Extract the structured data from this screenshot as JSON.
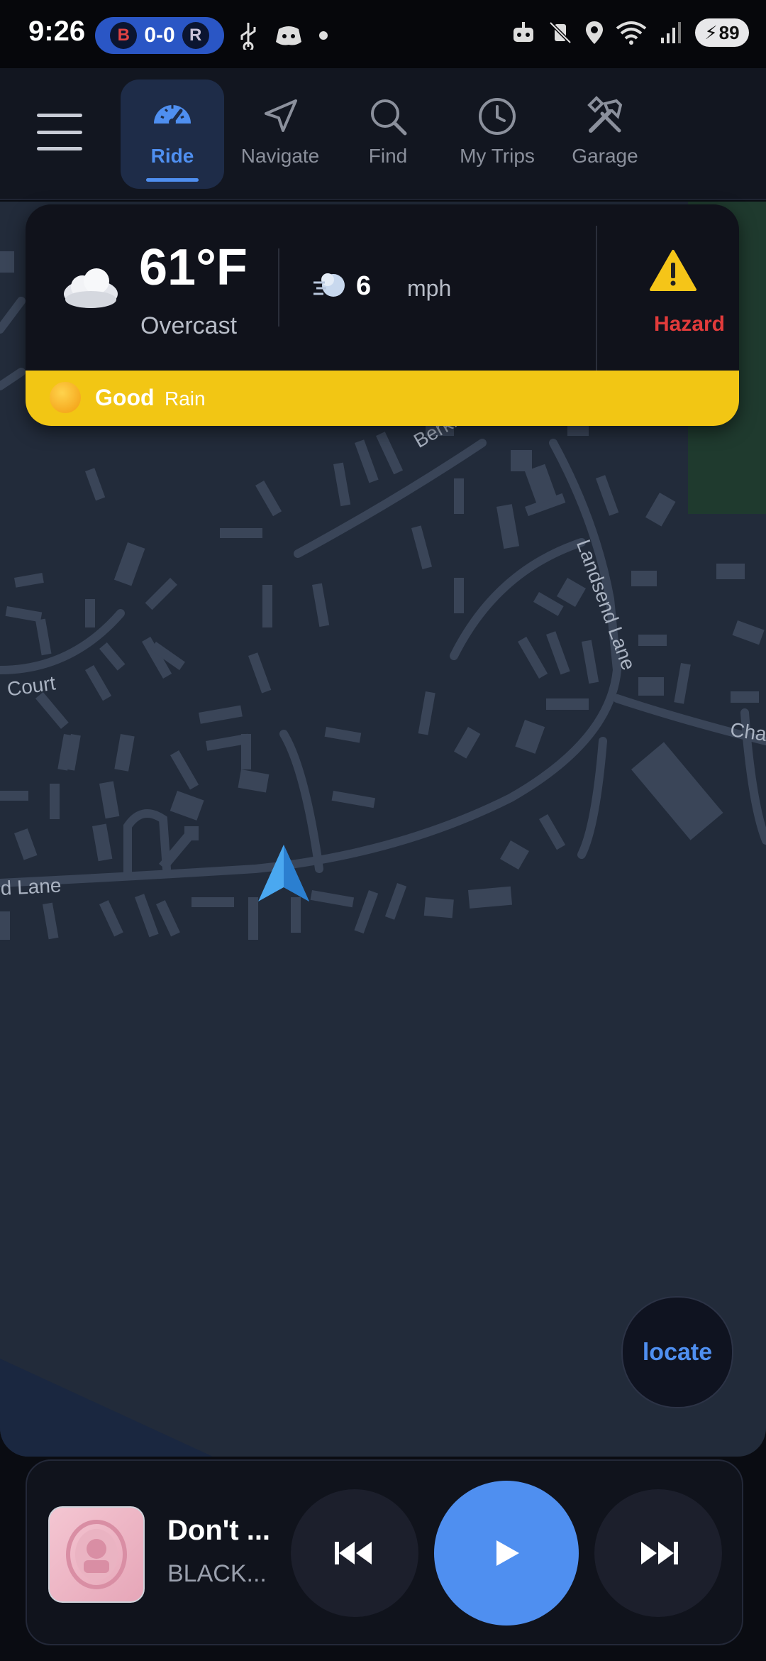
{
  "status_bar": {
    "time": "9:26",
    "score": "0-0",
    "team_left_icon": "red-sox-logo",
    "team_right_icon": "rockies-logo",
    "battery": "89"
  },
  "nav": {
    "tabs": [
      {
        "label": "Ride",
        "icon": "speedometer-icon",
        "active": true
      },
      {
        "label": "Navigate",
        "icon": "navigation-arrow-icon",
        "active": false
      },
      {
        "label": "Find",
        "icon": "search-icon",
        "active": false
      },
      {
        "label": "My Trips",
        "icon": "clock-icon",
        "active": false
      },
      {
        "label": "Garage",
        "icon": "tools-icon",
        "active": false
      }
    ]
  },
  "weather": {
    "temperature": "61°F",
    "condition": "Overcast",
    "wind_speed": "6",
    "wind_unit": "mph",
    "hazard_label": "Hazard",
    "rating": "Good",
    "precipitation": "Rain"
  },
  "map": {
    "streets": [
      "Berkley Co",
      "Landsend Lane",
      "Court",
      "Cha",
      "d Lane"
    ]
  },
  "locate_label": "locate",
  "media": {
    "title": "Don't ...",
    "artist": "BLACK..."
  },
  "colors": {
    "accent": "#4f8ff0",
    "hazard": "#e23b3b",
    "ride_quality": "#f2c614"
  }
}
